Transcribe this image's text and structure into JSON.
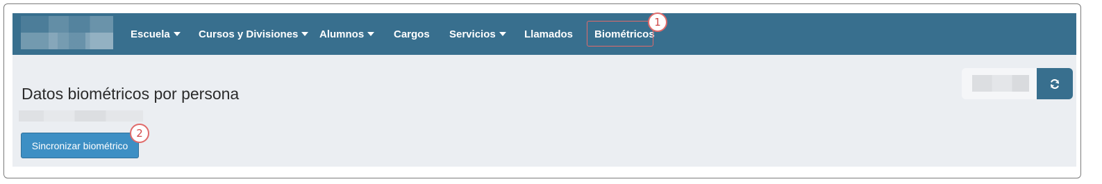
{
  "navbar": {
    "items": [
      {
        "label": "Escuela",
        "dropdown": true
      },
      {
        "label": "Cursos y Divisiones",
        "dropdown": true
      },
      {
        "label": "Alumnos",
        "dropdown": true
      },
      {
        "label": "Cargos",
        "dropdown": false
      },
      {
        "label": "Servicios",
        "dropdown": true
      },
      {
        "label": "Llamados",
        "dropdown": false
      },
      {
        "label": "Biométricos",
        "dropdown": false
      }
    ]
  },
  "annotations": {
    "marker1": "1",
    "marker2": "2"
  },
  "main": {
    "title": "Datos biométricos por persona",
    "sync_button_label": "Sincronizar biométrico"
  },
  "toolbar": {
    "refresh_icon": "refresh-icon"
  },
  "colors": {
    "navbar": "#386f8e",
    "primary_button": "#3d8fc4",
    "annotation": "#e06a6a",
    "background": "#ebeef2"
  }
}
